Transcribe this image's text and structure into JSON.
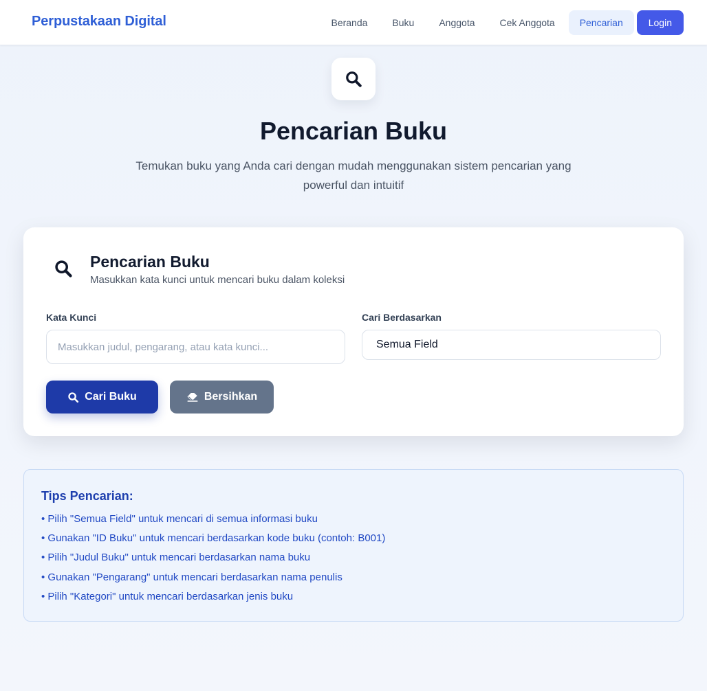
{
  "navbar": {
    "brand": "Perpustakaan Digital",
    "links": [
      "Beranda",
      "Buku",
      "Anggota",
      "Cek Anggota",
      "Pencarian"
    ],
    "active_link": "Pencarian",
    "login_label": "Login"
  },
  "hero": {
    "icon": "search-icon",
    "title": "Pencarian Buku",
    "subtitle": "Temukan buku yang Anda cari dengan mudah menggunakan sistem pencarian yang powerful dan intuitif"
  },
  "search_card": {
    "icon": "search-icon",
    "title": "Pencarian Buku",
    "description": "Masukkan kata kunci untuk mencari buku dalam koleksi",
    "keyword_label": "Kata Kunci",
    "keyword_value": "",
    "keyword_placeholder": "Masukkan judul, pengarang, atau kata kunci...",
    "search_by_label": "Cari Berdasarkan",
    "search_by_selected": "Semua Field",
    "search_button": "Cari Buku",
    "clear_button": "Bersihkan"
  },
  "tips": {
    "title": "Tips Pencarian:",
    "items": [
      "• Pilih \"Semua Field\" untuk mencari di semua informasi buku",
      "• Gunakan \"ID Buku\" untuk mencari berdasarkan kode buku (contoh: B001)",
      "• Pilih \"Judul Buku\" untuk mencari berdasarkan nama buku",
      "• Gunakan \"Pengarang\" untuk mencari berdasarkan nama penulis",
      "• Pilih \"Kategori\" untuk mencari berdasarkan jenis buku"
    ]
  },
  "colors": {
    "brand": "#2f5fd6",
    "login_button": "#4459e8",
    "search_button": "#1e3aa8",
    "clear_button": "#64748b",
    "tips_text": "#2149c4"
  }
}
